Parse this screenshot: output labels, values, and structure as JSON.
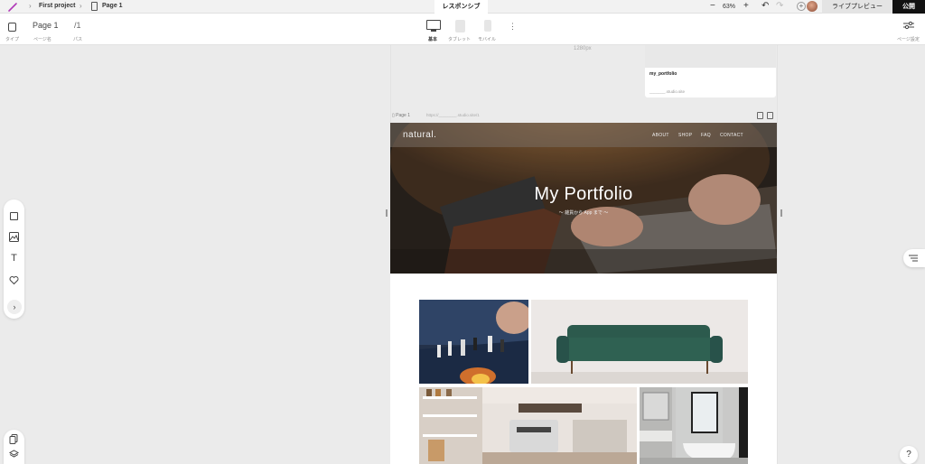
{
  "topbar": {
    "breadcrumb_project": "First project",
    "breadcrumb_page": "Page 1",
    "mode_tab": "レスポンシブ",
    "zoom_minus": "−",
    "zoom_level": "63%",
    "zoom_plus": "+",
    "preview_label": "ライブプレビュー",
    "publish_label": "公開"
  },
  "toolbar": {
    "type_label": "タイプ",
    "page_name": "Page 1",
    "page_name_label": "ページ名",
    "page_path": "/1",
    "page_path_label": "パス",
    "device_desktop_label": "基本",
    "device_tablet_label": "タブレット",
    "device_mobile_label": "モバイル",
    "page_settings_label": "ページ設定"
  },
  "canvas": {
    "ruler_width_label": "1280px"
  },
  "project_card": {
    "title": "my_portfolio",
    "url": "_______.studio.site"
  },
  "frame": {
    "page_label": "Page 1",
    "url": "https://________.studio.site/1"
  },
  "site": {
    "logo": "natural.",
    "nav": [
      "ABOUT",
      "SHOP",
      "FAQ",
      "CONTACT"
    ],
    "hero_title": "My Portfolio",
    "hero_subtitle": "〜 雑貨から App まで 〜"
  },
  "help_label": "?",
  "colors": {
    "publish_bg": "#111111",
    "canvas_bg": "#ebebeb",
    "sofa": "#2c5a4d"
  }
}
